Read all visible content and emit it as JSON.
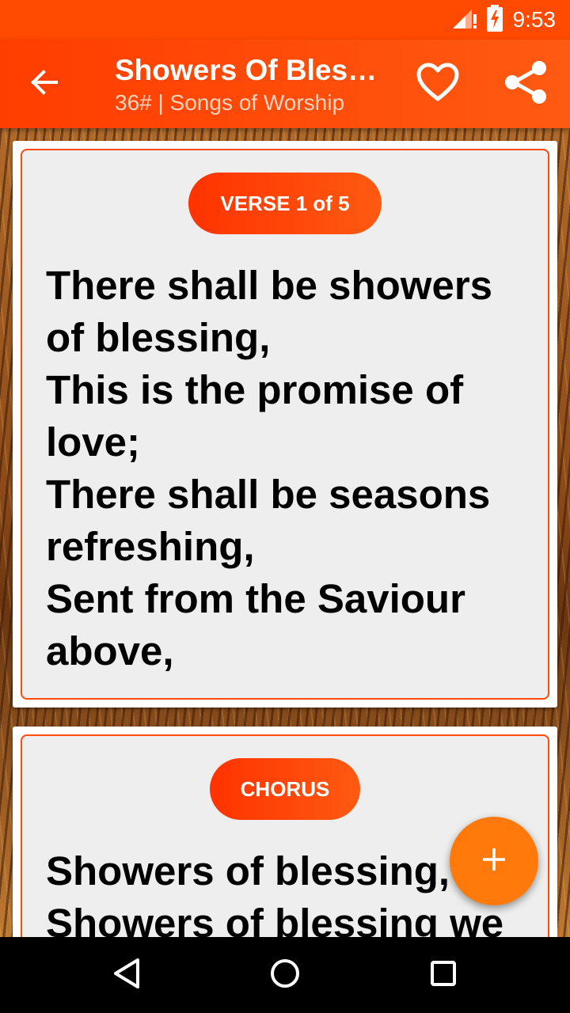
{
  "status_bar": {
    "time": "9:53",
    "icons": [
      "signal-icon",
      "battery-charging-icon"
    ]
  },
  "app_bar": {
    "title": "Showers Of Bles…",
    "subtitle": "36# | Songs of Worship",
    "back_icon": "arrow-back-icon",
    "favorite_icon": "heart-outline-icon",
    "share_icon": "share-icon"
  },
  "verses": [
    {
      "label": "VERSE 1 of 5",
      "lines": [
        "There shall be showers",
        "of blessing,",
        "This is the promise of",
        "love;",
        "There shall be seasons",
        "refreshing,",
        "Sent from the Saviour",
        "above,"
      ]
    },
    {
      "label": "CHORUS",
      "lines": [
        "Showers of blessing,",
        "Showers of blessing we"
      ]
    }
  ],
  "fab": {
    "icon": "plus-icon",
    "label": "+"
  },
  "nav_bar": {
    "icons": [
      "back-triangle-icon",
      "home-circle-icon",
      "recents-square-icon"
    ]
  },
  "colors": {
    "accent": "#ff4a00",
    "fab": "#ff7a0a",
    "card_bg": "#eeeeee"
  }
}
